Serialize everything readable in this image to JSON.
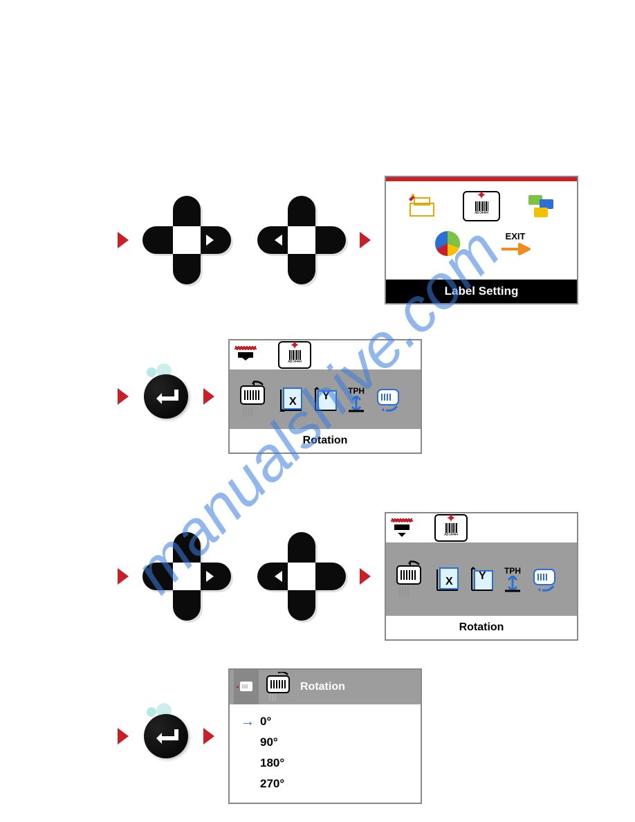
{
  "watermark": "manualshive.com",
  "screen_label_setting": {
    "title": "Label Setting",
    "icons": [
      "printer-setup-icon",
      "label-setting-icon",
      "devices-icon",
      "pie-chart-icon",
      "exit-icon"
    ],
    "exit_label": "EXIT"
  },
  "screen_rotation_a": {
    "footer": "Rotation"
  },
  "screen_rotation_b": {
    "footer": "Rotation"
  },
  "screen_rotation_list": {
    "header": "Rotation",
    "options": [
      "0°",
      "90°",
      "180°",
      "270°"
    ],
    "selected_index": 0
  },
  "submenu_icons": {
    "labels": [
      "rotation",
      "x-offset",
      "y-offset",
      "tph",
      "feed"
    ],
    "tph_label": "TPH",
    "x_label": "X",
    "y_label": "Y"
  }
}
